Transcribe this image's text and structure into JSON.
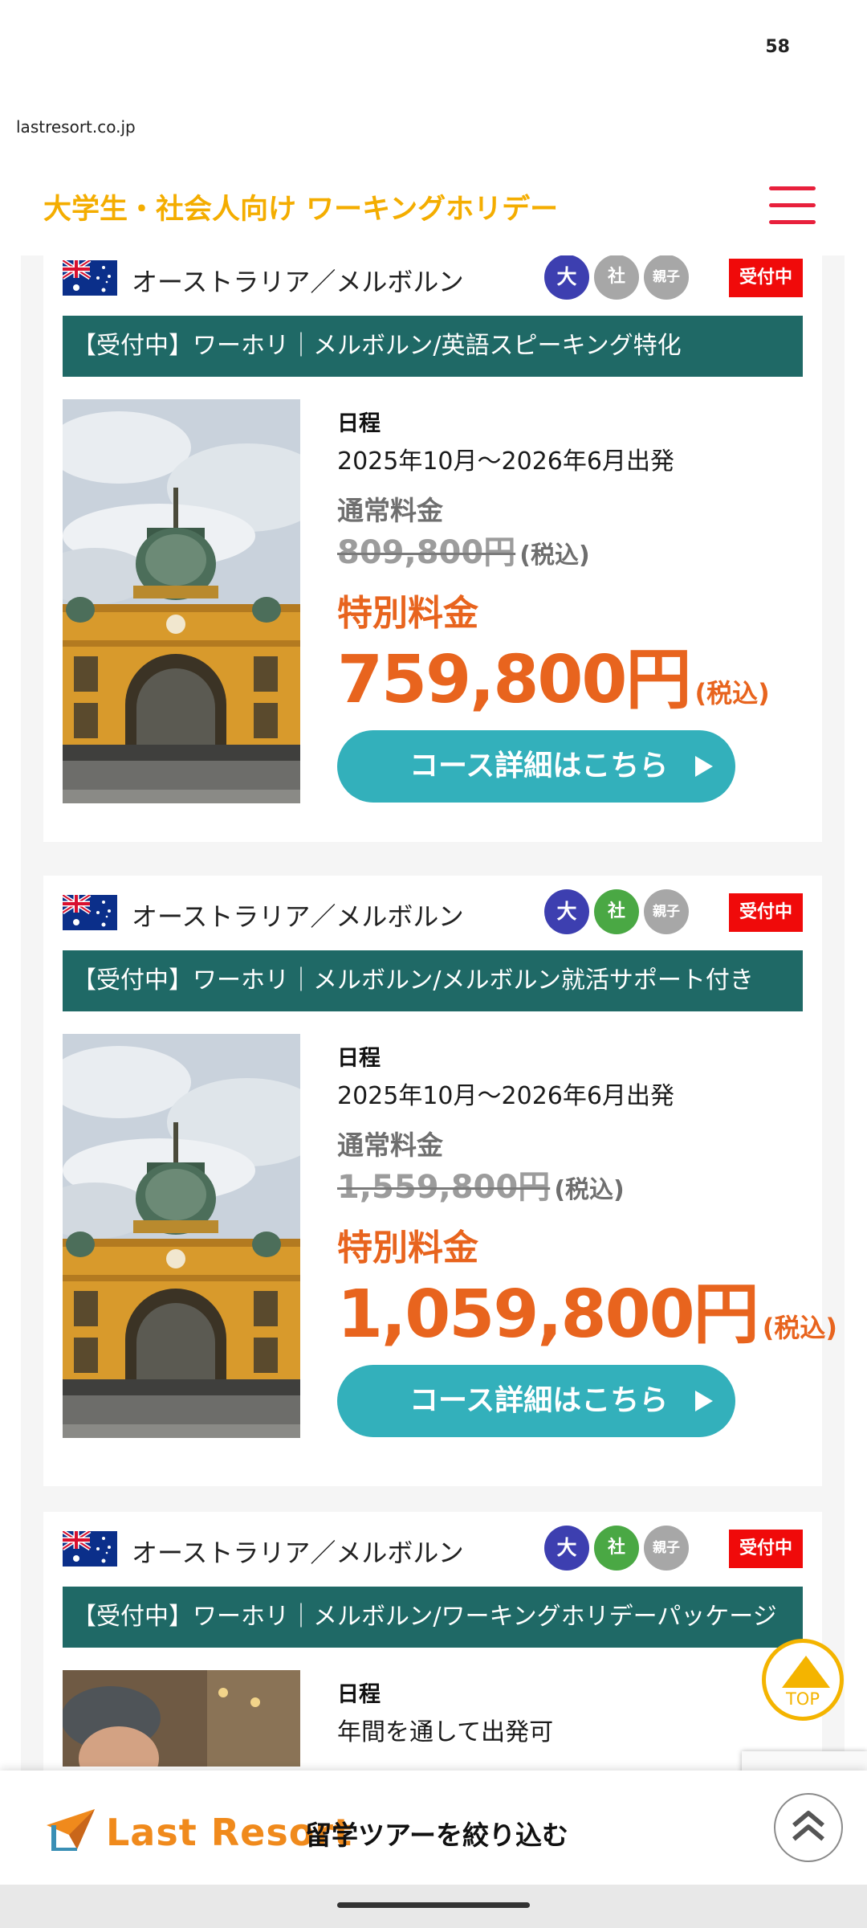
{
  "status_bar": {
    "number": "58"
  },
  "browser": {
    "url": "lastresort.co.jp"
  },
  "header": {
    "title": "大学生・社会人向け ワーキングホリデー"
  },
  "colors": {
    "brand_orange": "#e8641e",
    "title_yellow": "#f4ad00",
    "teal": "#1f6966",
    "button_teal": "#33b0bb",
    "badge_red": "#f00a0a",
    "badge_blue": "#3d3fb0",
    "badge_green": "#4aa844",
    "badge_gray": "#a7a7a7"
  },
  "cards": [
    {
      "region": "オーストラリア／メルボルン",
      "badges": [
        "大",
        "社",
        "親子"
      ],
      "status": "受付中",
      "title": "【受付中】ワーホリ｜メルボルン/英語スピーキング特化",
      "schedule_label": "日程",
      "schedule": "2025年10月〜2026年6月出発",
      "regular_label": "通常料金",
      "regular_price": "809,800円",
      "tax": "(税込)",
      "special_label": "特別料金",
      "special_price": "759,800円",
      "button": "コース詳細はこちら"
    },
    {
      "region": "オーストラリア／メルボルン",
      "badges": [
        "大",
        "社",
        "親子"
      ],
      "status": "受付中",
      "title": "【受付中】ワーホリ｜メルボルン/メルボルン就活サポート付き",
      "schedule_label": "日程",
      "schedule": "2025年10月〜2026年6月出発",
      "regular_label": "通常料金",
      "regular_price": "1,559,800円",
      "tax": "(税込)",
      "special_label": "特別料金",
      "special_price": "1,059,800円",
      "button": "コース詳細はこちら"
    },
    {
      "region": "オーストラリア／メルボルン",
      "badges": [
        "大",
        "社",
        "親子"
      ],
      "status": "受付中",
      "title": "【受付中】ワーホリ｜メルボルン/ワーキングホリデーパッケージ",
      "schedule_label": "日程",
      "schedule": "年間を通して出発可"
    }
  ],
  "top_button": {
    "label": "TOP"
  },
  "bottom_bar": {
    "logo": "Last Resort",
    "filter": "留学ツアーを絞り込む"
  }
}
